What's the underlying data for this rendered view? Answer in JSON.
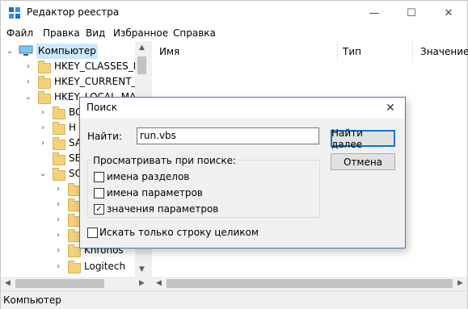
{
  "window": {
    "title": "Редактор реестра"
  },
  "window_controls": {
    "minimize": "—",
    "maximize": "☐",
    "close": "✕"
  },
  "menu": [
    "Файл",
    "Правка",
    "Вид",
    "Избранное",
    "Справка"
  ],
  "tree": {
    "root": "Компьютер",
    "hives": [
      "HKEY_CLASSES_RO",
      "HKEY_CURRENT_U",
      "HKEY_LOCAL_MAC"
    ],
    "subkeys_partial": [
      "BC",
      "H",
      "SA",
      "SE",
      "SO"
    ],
    "visible_bottom": [
      "Khronos",
      "Logitech"
    ]
  },
  "list": {
    "columns": [
      "Имя",
      "Тип",
      "Значение"
    ]
  },
  "status": {
    "path": "Компьютер"
  },
  "find_dialog": {
    "title": "Поиск",
    "find_label": "Найти:",
    "find_value": "run.vbs",
    "find_next_button": "Найти далее",
    "cancel_button": "Отмена",
    "look_at_label": "Просматривать при поиске:",
    "options": [
      {
        "label": "имена разделов",
        "checked": false
      },
      {
        "label": "имена параметров",
        "checked": false
      },
      {
        "label": "значения параметров",
        "checked": true
      }
    ],
    "whole_string_label": "Искать только строку целиком",
    "whole_string_checked": false
  }
}
